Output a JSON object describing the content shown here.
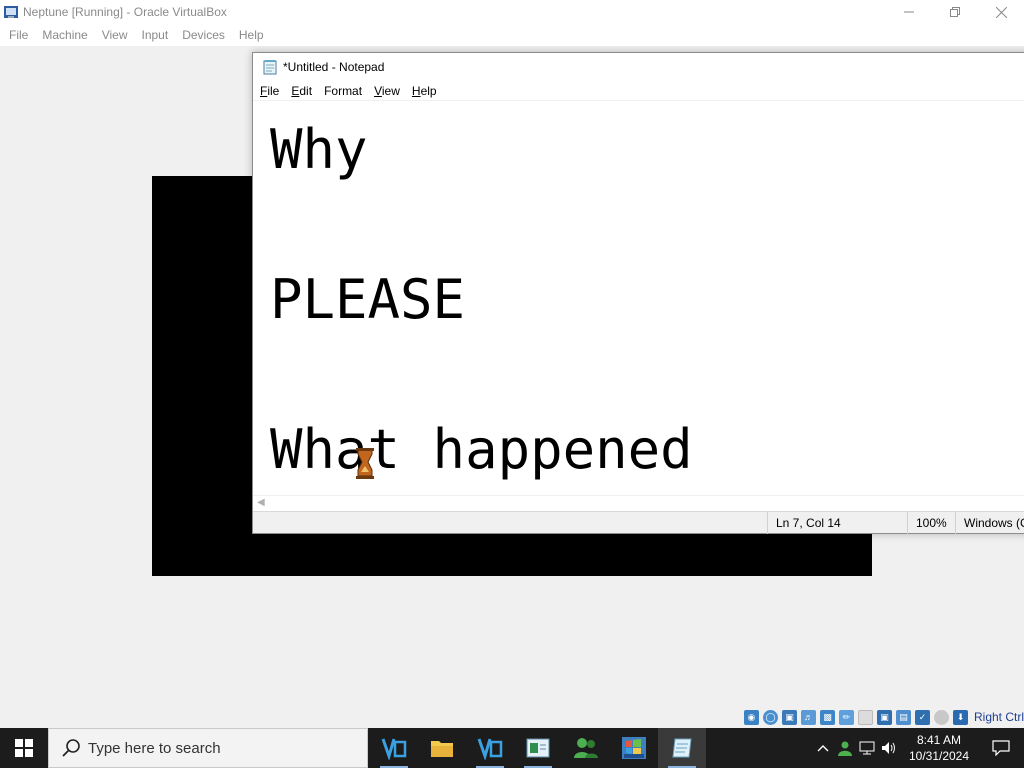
{
  "host_window": {
    "title": "Neptune [Running] - Oracle VirtualBox",
    "menu": [
      "File",
      "Machine",
      "View",
      "Input",
      "Devices",
      "Help"
    ],
    "host_key_label": "Right Ctrl"
  },
  "notepad": {
    "title": "*Untitled - Notepad",
    "menu": [
      {
        "key": "F",
        "rest": "ile"
      },
      {
        "key": "E",
        "rest": "dit"
      },
      {
        "key": "F",
        "rest": "ormat",
        "key_pos": "prefix_o"
      },
      {
        "key": "V",
        "rest": "iew"
      },
      {
        "key": "H",
        "rest": "elp"
      }
    ],
    "menu_labels": [
      "File",
      "Edit",
      "Format",
      "View",
      "Help"
    ],
    "lines": [
      "Why",
      "",
      "PLEASE",
      "",
      "What happened"
    ],
    "status": {
      "position": "Ln 7, Col 14",
      "zoom": "100%",
      "line_ending": "Windows (C"
    }
  },
  "taskbar": {
    "search_placeholder": "Type here to search",
    "time": "8:41 AM",
    "date": "10/31/2024",
    "tray_chevron": "^"
  }
}
